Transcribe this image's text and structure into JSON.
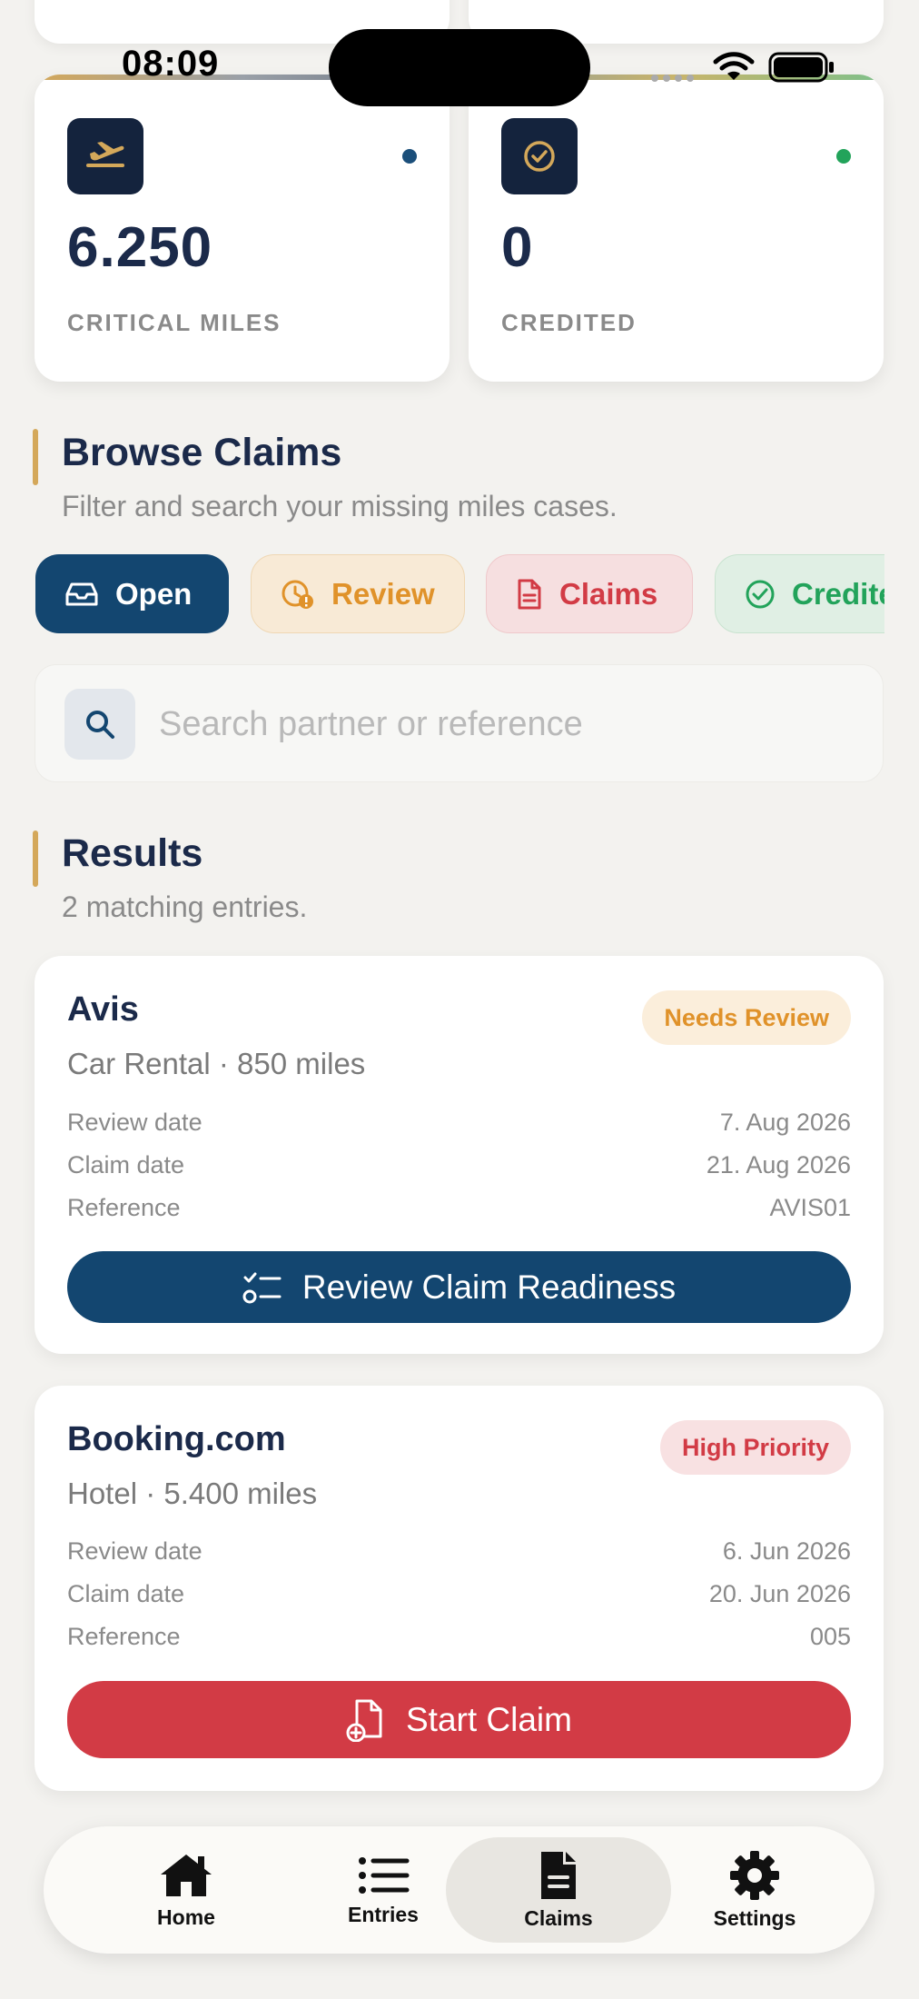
{
  "status_bar": {
    "time": "08:09"
  },
  "stats": [
    {
      "value": "6.250",
      "label": "CRITICAL MILES",
      "icon": "airplane-takeoff-icon",
      "dot_color": "#1b4f7a"
    },
    {
      "value": "0",
      "label": "CREDITED",
      "icon": "check-circle-icon",
      "dot_color": "#22a35a"
    }
  ],
  "browse": {
    "title": "Browse Claims",
    "subtitle": "Filter and search your missing miles cases."
  },
  "filters": [
    {
      "label": "Open",
      "icon": "inbox-icon",
      "active": true
    },
    {
      "label": "Review",
      "icon": "clock-alert-icon",
      "active": false
    },
    {
      "label": "Claims",
      "icon": "document-icon",
      "active": false
    },
    {
      "label": "Credited",
      "icon": "check-circle-icon",
      "active": false
    }
  ],
  "search": {
    "placeholder": "Search partner or reference",
    "value": ""
  },
  "results": {
    "title": "Results",
    "subtitle": "2 matching entries.",
    "items": [
      {
        "partner": "Avis",
        "summary": "Car Rental · 850 miles",
        "badge": "Needs Review",
        "rows": [
          {
            "label": "Review date",
            "value": "7. Aug 2026"
          },
          {
            "label": "Claim date",
            "value": "21. Aug 2026"
          },
          {
            "label": "Reference",
            "value": "AVIS01"
          }
        ],
        "action": "Review Claim Readiness"
      },
      {
        "partner": "Booking.com",
        "summary": "Hotel · 5.400 miles",
        "badge": "High Priority",
        "rows": [
          {
            "label": "Review date",
            "value": "6. Jun 2026"
          },
          {
            "label": "Claim date",
            "value": "20. Jun 2026"
          },
          {
            "label": "Reference",
            "value": "005"
          }
        ],
        "action": "Start Claim"
      }
    ]
  },
  "nav": [
    {
      "label": "Home",
      "icon": "home-icon"
    },
    {
      "label": "Entries",
      "icon": "list-icon"
    },
    {
      "label": "Claims",
      "icon": "document-icon",
      "active": true
    },
    {
      "label": "Settings",
      "icon": "gear-icon"
    }
  ],
  "colors": {
    "navy": "#1b2a4a",
    "primary_button": "#134670",
    "danger_button": "#d23b45",
    "accent": "#d4a85a",
    "review_orange": "#e0922a",
    "credited_green": "#22a35a"
  }
}
